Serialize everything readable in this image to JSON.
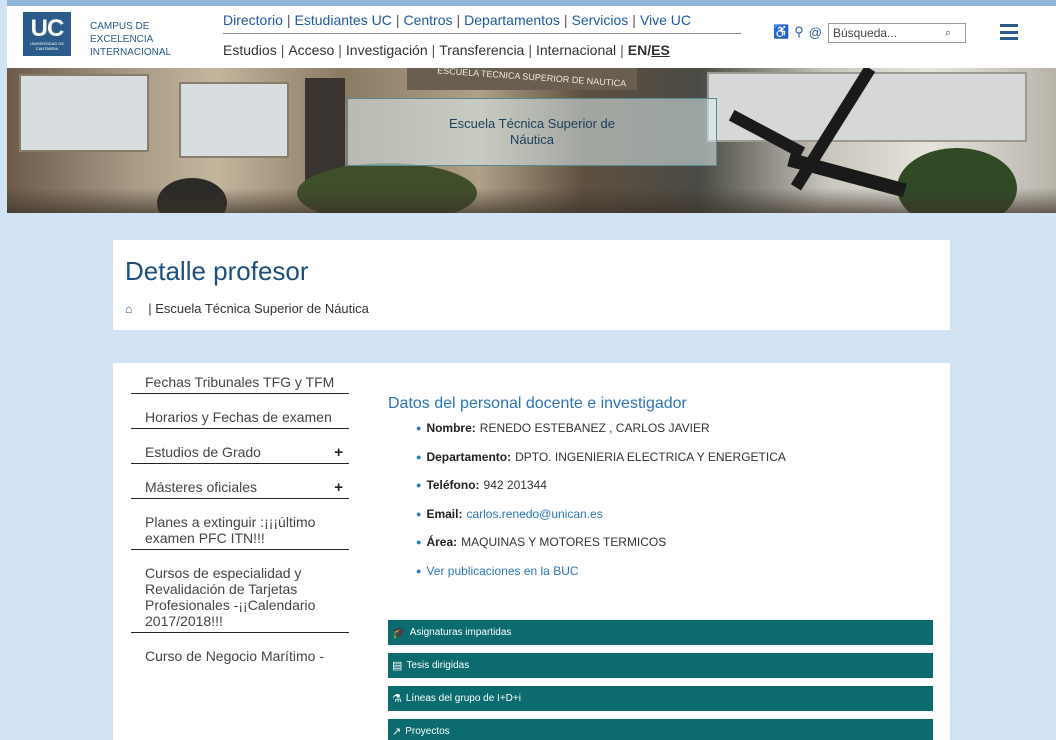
{
  "logo": {
    "text": "UC",
    "subtext": "UNIVERSIDAD DE CANTABRIA"
  },
  "campus": {
    "line1": "CAMPUS DE",
    "line2": "EXCELENCIA",
    "line3": "INTERNACIONAL"
  },
  "top_nav": [
    "Directorio",
    "Estudiantes UC",
    "Centros",
    "Departamentos",
    "Servicios",
    "Vive UC"
  ],
  "second_nav": [
    "Estudios",
    "Acceso",
    "Investigación",
    "Transferencia",
    "Internacional"
  ],
  "lang": {
    "en": "EN",
    "slash": "/",
    "es": "ES"
  },
  "tools": {
    "accessibility": "♿",
    "location": "⚲",
    "at": "@"
  },
  "search": {
    "placeholder": "Búsqueda...",
    "icon": "⌕"
  },
  "banner": {
    "title": "Escuela Técnica Superior de Náutica",
    "sign": "ESCUELA TECNICA SUPERIOR DE NAUTICA"
  },
  "page": {
    "title": "Detalle profesor",
    "breadcrumb": "| Escuela Técnica Superior de Náutica",
    "home_icon": "⌂"
  },
  "sidebar": {
    "items": [
      {
        "label": "Fechas Tribunales TFG y TFM",
        "plus": ""
      },
      {
        "label": "Horarios y Fechas de examen",
        "plus": ""
      },
      {
        "label": "Estudios de Grado",
        "plus": "+"
      },
      {
        "label": "Másteres oficiales",
        "plus": "+"
      },
      {
        "label": "Planes a extinguir :¡¡¡último examen PFC ITN!!!",
        "plus": ""
      },
      {
        "label": "Cursos de especialidad y Revalidación de Tarjetas Profesionales -¡¡Calendario 2017/2018!!!",
        "plus": ""
      },
      {
        "label": "Curso de Negocio Marítimo -",
        "plus": ""
      }
    ]
  },
  "profile": {
    "heading": "Datos del personal docente e investigador",
    "nombre_label": "Nombre:",
    "nombre": "RENEDO ESTEBANEZ , CARLOS JAVIER",
    "departamento_label": "Departamento:",
    "departamento": "DPTO. INGENIERIA ELECTRICA Y ENERGETICA",
    "telefono_label": "Teléfono:",
    "telefono": "942 201344",
    "email_label": "Email:",
    "email": "carlos.renedo@unican.es",
    "area_label": "Área:",
    "area": "MAQUINAS Y MOTORES TERMICOS",
    "publicaciones": "Ver publicaciones en la BUC"
  },
  "sections": [
    {
      "icon": "🎓",
      "label": "Asignaturas impartidas"
    },
    {
      "icon": "▤",
      "label": "Tesis dirigidas"
    },
    {
      "icon": "⚗",
      "label": "Líneas del grupo de I+D+i"
    },
    {
      "icon": "↗",
      "label": "Proyectos"
    }
  ]
}
